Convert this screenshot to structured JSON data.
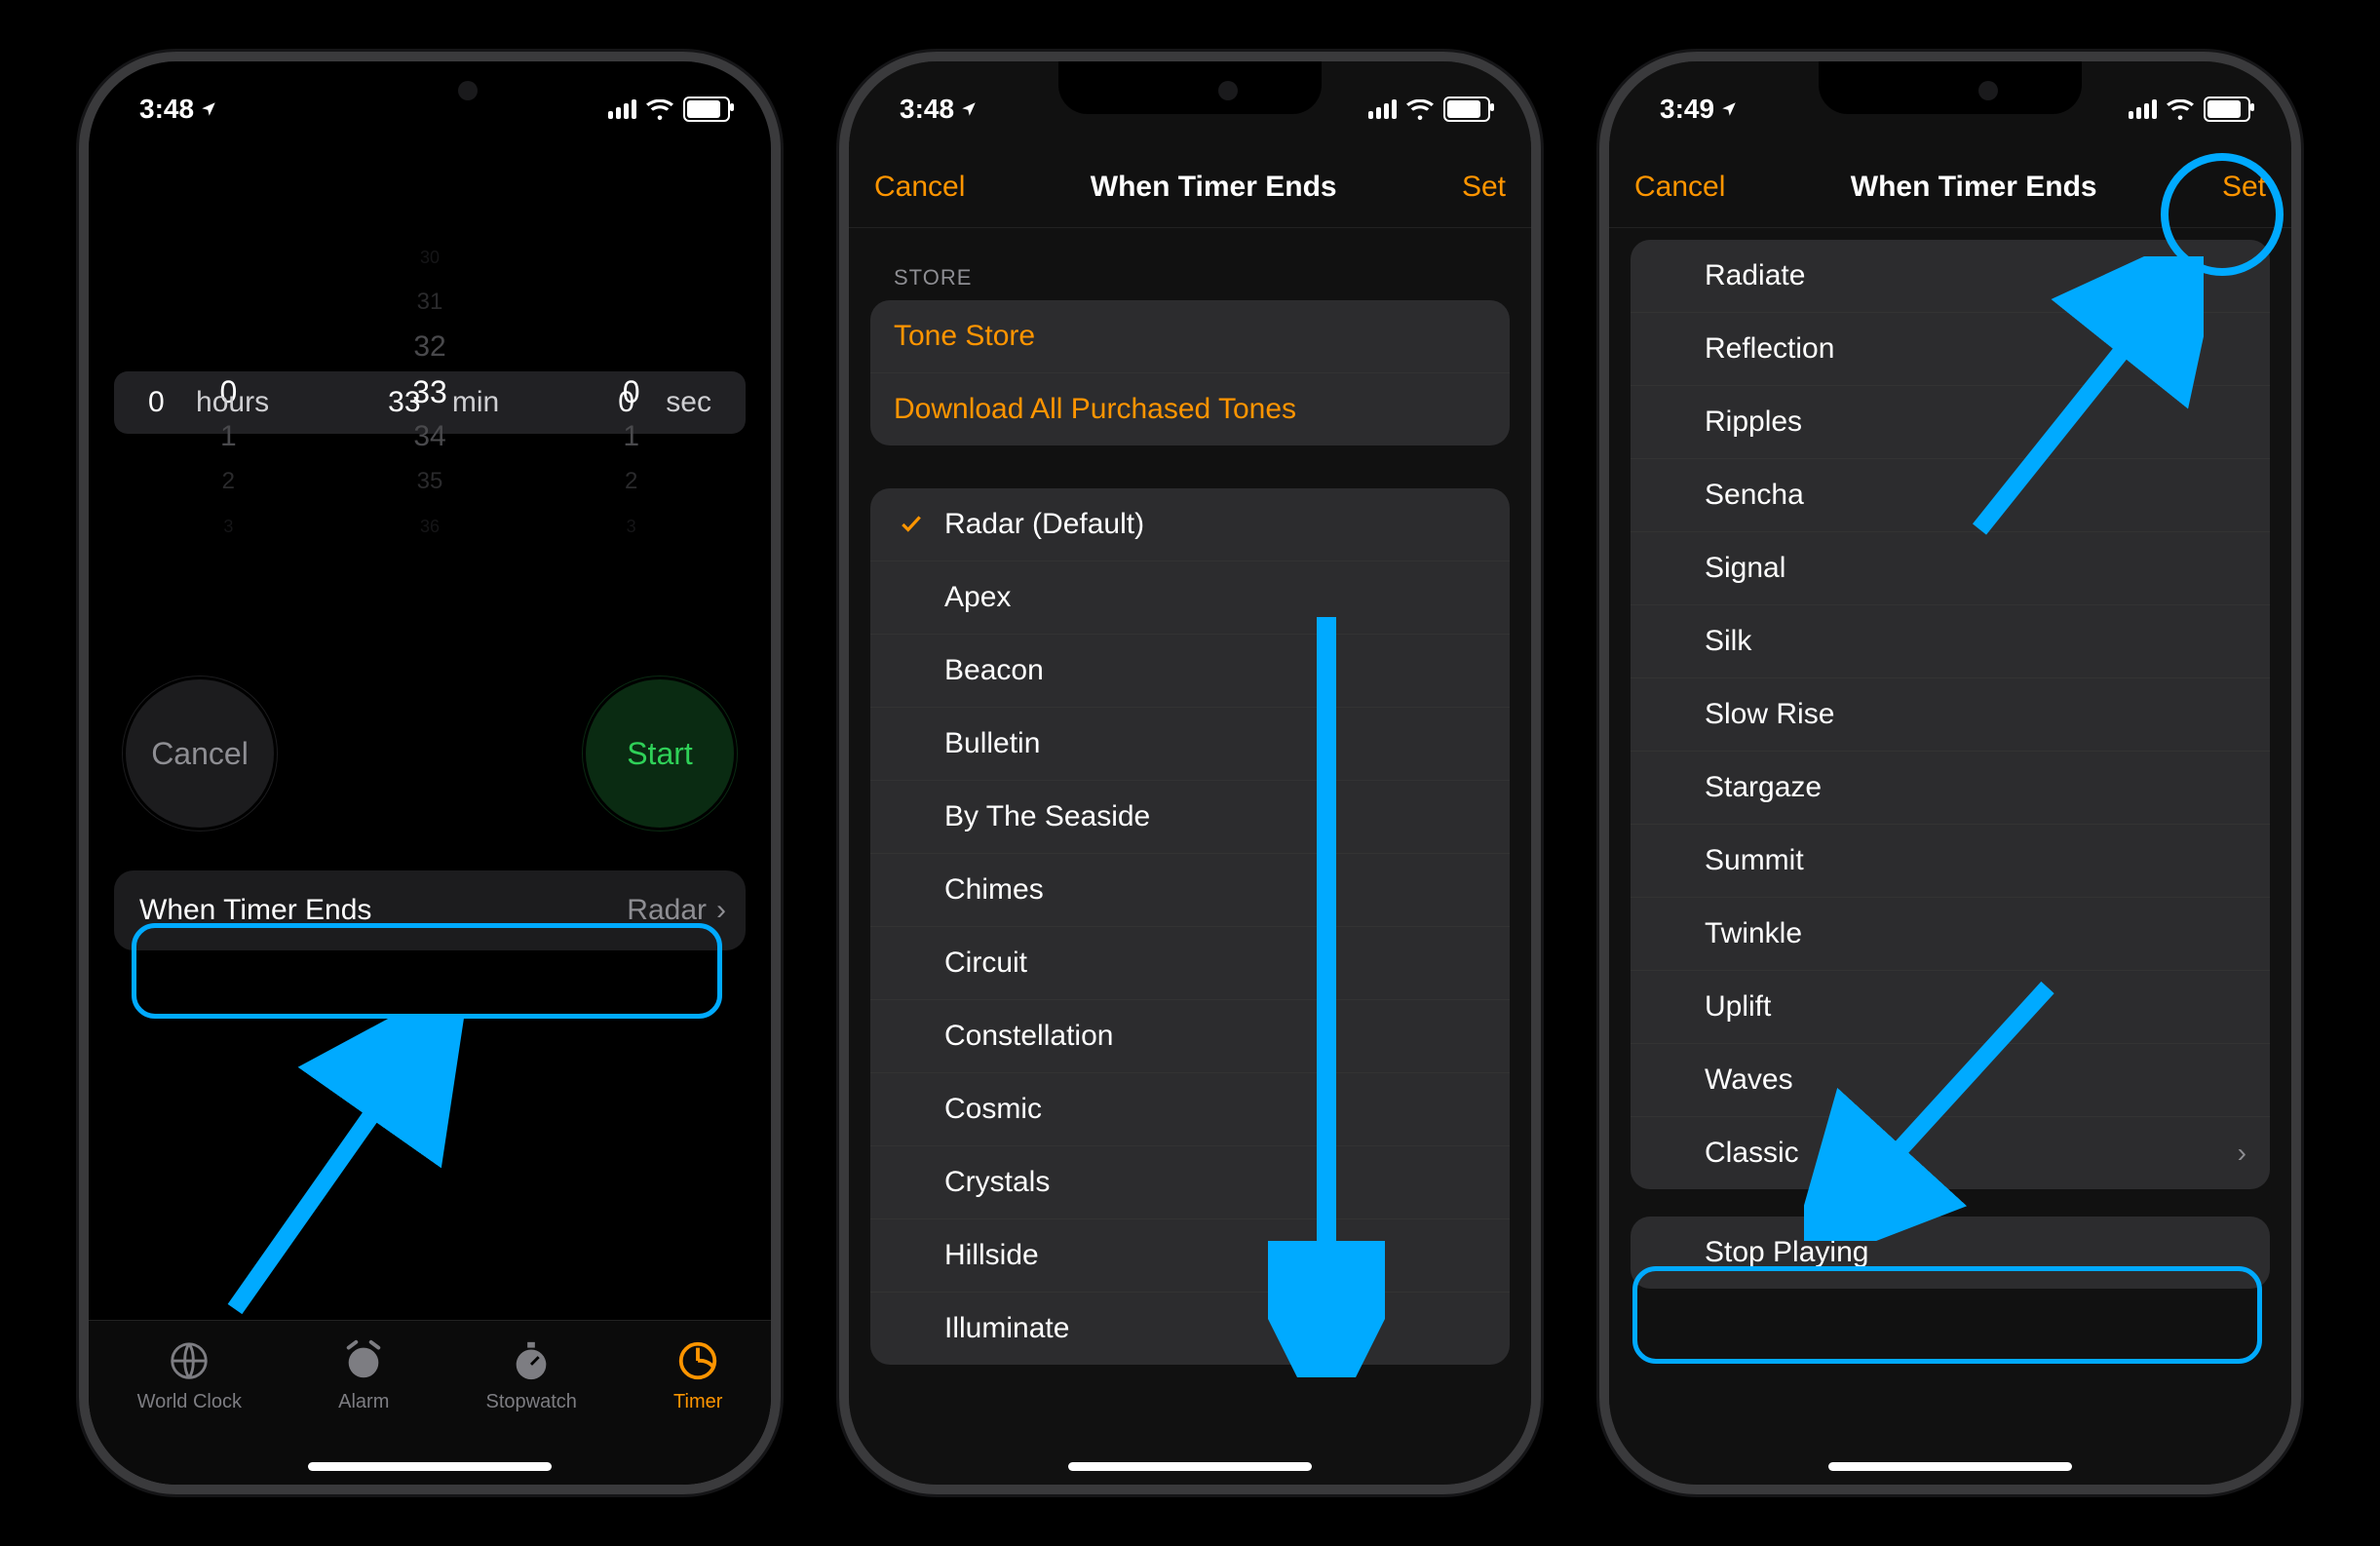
{
  "statusbar": {
    "time_a": "3:48",
    "time_b": "3:48",
    "time_c": "3:49"
  },
  "colors": {
    "highlight": "#00aaff",
    "accent": "#ff9500"
  },
  "timer_screen": {
    "picker": {
      "hours": "0",
      "hours_unit": "hours",
      "minutes": "33",
      "minutes_unit": "min",
      "seconds": "0",
      "seconds_unit": "sec",
      "mins_neighbors": [
        "30",
        "31",
        "32",
        "33",
        "34",
        "35",
        "36"
      ],
      "one": "1",
      "two": "2",
      "three": "3"
    },
    "cancel": "Cancel",
    "start": "Start",
    "when_timer_ends_label": "When Timer Ends",
    "when_timer_ends_value": "Radar",
    "tabs": {
      "world_clock": "World Clock",
      "alarm": "Alarm",
      "stopwatch": "Stopwatch",
      "timer": "Timer"
    }
  },
  "tone_screen": {
    "nav": {
      "cancel": "Cancel",
      "title": "When Timer Ends",
      "set": "Set"
    },
    "section_store": "STORE",
    "store_items": {
      "tone_store": "Tone Store",
      "download": "Download All Purchased Tones"
    },
    "tones": [
      "Radar (Default)",
      "Apex",
      "Beacon",
      "Bulletin",
      "By The Seaside",
      "Chimes",
      "Circuit",
      "Constellation",
      "Cosmic",
      "Crystals",
      "Hillside",
      "Illuminate"
    ]
  },
  "tone_screen_bottom": {
    "nav": {
      "cancel": "Cancel",
      "title": "When Timer Ends",
      "set": "Set"
    },
    "tones": [
      "Radiate",
      "Reflection",
      "Ripples",
      "Sencha",
      "Signal",
      "Silk",
      "Slow Rise",
      "Stargaze",
      "Summit",
      "Twinkle",
      "Uplift",
      "Waves"
    ],
    "classic_label": "Classic",
    "stop_playing": "Stop Playing"
  }
}
